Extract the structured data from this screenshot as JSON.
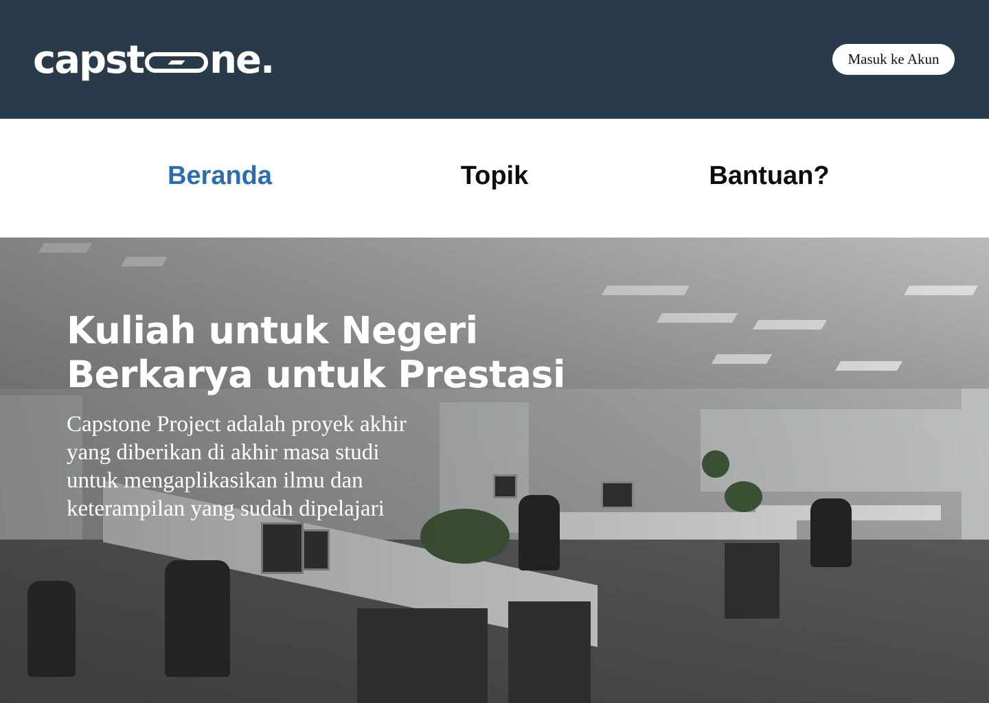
{
  "header": {
    "logo_text_left": "capst",
    "logo_text_right": "ne.",
    "login_label": "Masuk ke Akun"
  },
  "nav": {
    "items": [
      {
        "label": "Beranda",
        "active": true
      },
      {
        "label": "Topik",
        "active": false
      },
      {
        "label": "Bantuan?",
        "active": false
      }
    ]
  },
  "hero": {
    "title_line1": "Kuliah untuk Negeri",
    "title_line2": "Berkarya untuk Prestasi",
    "description": "Capstone Project adalah proyek akhir yang diberikan di akhir masa studi untuk mengaplikasikan ilmu dan keterampilan yang sudah dipelajari",
    "image_subject": "open-plan office interior"
  },
  "colors": {
    "header_bg": "#293a4b",
    "nav_active": "#2a6db5",
    "nav_text": "#0d0d0d"
  }
}
